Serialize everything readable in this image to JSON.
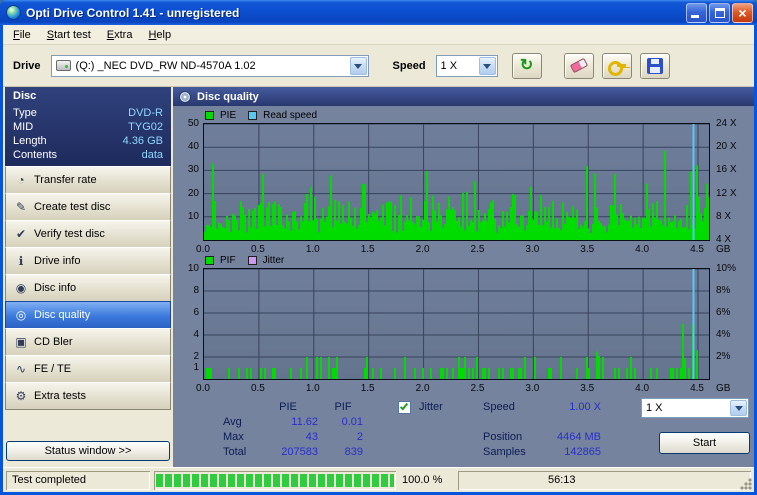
{
  "window": {
    "title": "Opti Drive Control 1.41 - unregistered"
  },
  "menu": {
    "items": [
      {
        "label": "File"
      },
      {
        "label": "Start test"
      },
      {
        "label": "Extra"
      },
      {
        "label": "Help"
      }
    ]
  },
  "toolbar": {
    "drive_label": "Drive",
    "drive_value": "(Q:)  _NEC DVD_RW ND-4570A 1.02",
    "speed_label": "Speed",
    "speed_value": "1 X"
  },
  "icons": {
    "refresh": "↻",
    "transfer_rate": "◔",
    "create_test_disc": "✎",
    "verify_test_disc": "✔",
    "drive_info": "ℹ",
    "disc_info": "◉",
    "disc_quality": "◎",
    "cd_bler": "▣",
    "fe_te": "∿",
    "extra_tests": "⚙"
  },
  "sidebar": {
    "panel_title": "Disc",
    "info": [
      {
        "label": "Type",
        "value": "DVD-R"
      },
      {
        "label": "MID",
        "value": "TYG02"
      },
      {
        "label": "Length",
        "value": "4.36 GB"
      },
      {
        "label": "Contents",
        "value": "data"
      }
    ],
    "buttons": [
      {
        "label": "Transfer rate",
        "selected": false
      },
      {
        "label": "Create test disc",
        "selected": false
      },
      {
        "label": "Verify test disc",
        "selected": false
      },
      {
        "label": "Drive info",
        "selected": false
      },
      {
        "label": "Disc info",
        "selected": false
      },
      {
        "label": "Disc quality",
        "selected": true
      },
      {
        "label": "CD Bler",
        "selected": false
      },
      {
        "label": "FE / TE",
        "selected": false
      },
      {
        "label": "Extra tests",
        "selected": false
      }
    ],
    "status_window_label": "Status window >>"
  },
  "main": {
    "header": "Disc quality"
  },
  "chart_data": [
    {
      "type": "area",
      "title": "PIE / Read speed vs position",
      "legend": [
        {
          "label": "PIE",
          "color": "#00DC00"
        },
        {
          "label": "Read speed",
          "color": "#55C8F5"
        }
      ],
      "x": {
        "min": 0,
        "max": 4.6,
        "ticks": [
          0,
          0.5,
          1,
          1.5,
          2,
          2.5,
          3,
          3.5,
          4,
          4.5
        ],
        "unit": "GB"
      },
      "y_left": {
        "min": 0,
        "max": 50,
        "ticks": [
          50,
          40,
          30,
          20,
          10
        ],
        "grid": [
          10,
          20,
          30,
          40,
          50
        ]
      },
      "y_right": {
        "labels": [
          "24 X",
          "20 X",
          "16 X",
          "12 X",
          "8 X",
          "4 X"
        ]
      },
      "summary": {
        "avg": 11.62,
        "max": 43,
        "total": 207583
      },
      "envelope_max_per_half_gb": [
        34,
        30,
        28,
        32,
        30,
        28,
        34,
        36,
        30,
        46
      ],
      "read_speed_marker_gb": 4.45,
      "grid_on": true,
      "legend_position": "top-left"
    },
    {
      "type": "area",
      "title": "PIF / Jitter vs position",
      "legend": [
        {
          "label": "PIF",
          "color": "#00DC00"
        },
        {
          "label": "Jitter",
          "color": "#CC99F2"
        }
      ],
      "x": {
        "min": 0,
        "max": 4.6,
        "ticks": [
          0,
          0.5,
          1,
          1.5,
          2,
          2.5,
          3,
          3.5,
          4,
          4.5
        ],
        "unit": "GB"
      },
      "y_left": {
        "min": 0,
        "max": 10,
        "ticks": [
          10,
          8,
          6,
          4,
          2,
          1
        ],
        "grid": [
          2,
          4,
          6,
          8,
          10
        ]
      },
      "y_right": {
        "labels": [
          "10%",
          "8%",
          "6%",
          "4%",
          "2%"
        ]
      },
      "summary": {
        "avg": 0.01,
        "max": 2,
        "total": 839
      },
      "spike_clusters": [
        {
          "gb": 3.6,
          "max": 4
        },
        {
          "gb": 4.4,
          "max": 6
        }
      ],
      "read_speed_marker_gb": 4.45,
      "grid_on": true,
      "legend_position": "top-left"
    }
  ],
  "stats": {
    "pie_header": "PIE",
    "pif_header": "PIF",
    "rows": [
      {
        "label": "Avg",
        "pie": "11.62",
        "pif": "0.01"
      },
      {
        "label": "Max",
        "pie": "43",
        "pif": "2"
      },
      {
        "label": "Total",
        "pie": "207583",
        "pif": "839"
      }
    ],
    "jitter_label": "Jitter",
    "jitter_checked": true,
    "speed_label": "Speed",
    "speed_value": "1.00 X",
    "speed_select_value": "1 X",
    "position_label": "Position",
    "position_value": "4464 MB",
    "samples_label": "Samples",
    "samples_value": "142865",
    "start_label": "Start"
  },
  "statusbar": {
    "status_text": "Test completed",
    "progress_percent": 100,
    "progress_text": "100.0 %",
    "time_text": "56:13"
  },
  "colors": {
    "titlebar_blue": "#0C50D2",
    "selected_blue": "#2E6FD6",
    "panel_navy": "#202F66",
    "value_cyan": "#8FD8FF",
    "chart_bg": "#6F7E9A",
    "bar_green": "#00DC00",
    "readspeed_blue": "#55C8F5",
    "jitter_violet": "#CC99F2",
    "stat_value_blue": "#2730C8"
  }
}
